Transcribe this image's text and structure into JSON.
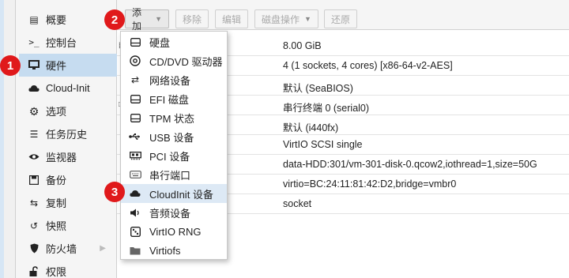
{
  "sidebar": {
    "items": [
      {
        "label": "概要",
        "icon": "book-icon"
      },
      {
        "label": "控制台",
        "icon": "terminal-icon"
      },
      {
        "label": "硬件",
        "icon": "monitor-icon"
      },
      {
        "label": "Cloud-Init",
        "icon": "cloud-icon"
      },
      {
        "label": "选项",
        "icon": "gear-icon"
      },
      {
        "label": "任务历史",
        "icon": "list-icon"
      },
      {
        "label": "监视器",
        "icon": "eye-icon"
      },
      {
        "label": "备份",
        "icon": "floppy-icon"
      },
      {
        "label": "复制",
        "icon": "retweet-icon"
      },
      {
        "label": "快照",
        "icon": "history-icon"
      },
      {
        "label": "防火墙",
        "icon": "shield-icon"
      },
      {
        "label": "权限",
        "icon": "unlock-icon"
      }
    ]
  },
  "toolbar": {
    "add": "添加",
    "remove": "移除",
    "edit": "编辑",
    "disk_action": "磁盘操作",
    "revert": "还原"
  },
  "hardware_rows": [
    "8.00 GiB",
    "4 (1 sockets, 4 cores) [x86-64-v2-AES]",
    "默认 (SeaBIOS)",
    "串行终端 0 (serial0)",
    "默认 (i440fx)",
    "VirtIO SCSI single",
    "data-HDD:301/vm-301-disk-0.qcow2,iothread=1,size=50G",
    "virtio=BC:24:11:81:42:D2,bridge=vmbr0",
    "socket"
  ],
  "add_menu": [
    {
      "label": "硬盘",
      "icon": "hdd-icon"
    },
    {
      "label": "CD/DVD 驱动器",
      "icon": "cdrom-icon"
    },
    {
      "label": "网络设备",
      "icon": "exchange-icon"
    },
    {
      "label": "EFI 磁盘",
      "icon": "hdd-icon"
    },
    {
      "label": "TPM 状态",
      "icon": "hdd-icon"
    },
    {
      "label": "USB 设备",
      "icon": "usb-icon"
    },
    {
      "label": "PCI 设备",
      "icon": "pci-card-icon"
    },
    {
      "label": "串行端口",
      "icon": "keyboard-icon"
    },
    {
      "label": "CloudInit 设备",
      "icon": "cloud-icon"
    },
    {
      "label": "音频设备",
      "icon": "volume-icon"
    },
    {
      "label": "VirtIO RNG",
      "icon": "dice-icon"
    },
    {
      "label": "Virtiofs",
      "icon": "folder-icon"
    }
  ],
  "callouts": [
    "1",
    "2",
    "3"
  ],
  "colors": {
    "callout": "#e0191b",
    "active_nav": "#c6dcf0",
    "menu_highlight": "#dde9f5"
  }
}
